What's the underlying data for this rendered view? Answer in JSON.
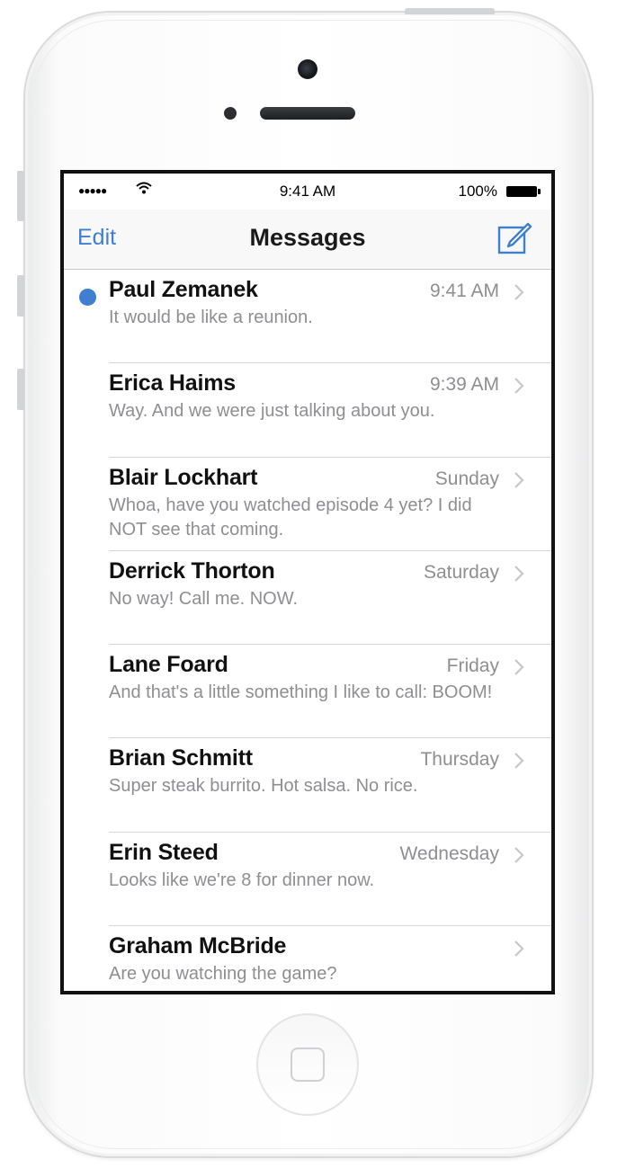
{
  "status_bar": {
    "signal": "●●●●●",
    "time": "9:41 AM",
    "battery": "100%"
  },
  "nav": {
    "edit_label": "Edit",
    "title": "Messages",
    "compose_icon": "compose-icon"
  },
  "colors": {
    "accent": "#3f7fd0",
    "unread_dot": "#3e7fd1",
    "secondary_text": "#8e8e93"
  },
  "messages": [
    {
      "name": "Paul Zemanek",
      "time": "9:41 AM",
      "preview": "It would be like a reunion.",
      "unread": true
    },
    {
      "name": "Erica Haims",
      "time": "9:39 AM",
      "preview": "Way. And we were just talking about you.",
      "unread": false
    },
    {
      "name": "Blair Lockhart",
      "time": "Sunday",
      "preview": "Whoa, have you watched episode 4 yet? I did NOT see that coming.",
      "unread": false
    },
    {
      "name": "Derrick Thorton",
      "time": "Saturday",
      "preview": "No way! Call me. NOW.",
      "unread": false
    },
    {
      "name": "Lane Foard",
      "time": "Friday",
      "preview": "And that's a little something I like to call: BOOM!",
      "unread": false
    },
    {
      "name": "Brian Schmitt",
      "time": "Thursday",
      "preview": "Super steak burrito. Hot salsa. No rice.",
      "unread": false
    },
    {
      "name": "Erin Steed",
      "time": "Wednesday",
      "preview": "Looks like we're 8 for dinner now.",
      "unread": false
    },
    {
      "name": "Graham McBride",
      "time": "",
      "preview": "Are you watching the game?",
      "unread": false
    }
  ]
}
